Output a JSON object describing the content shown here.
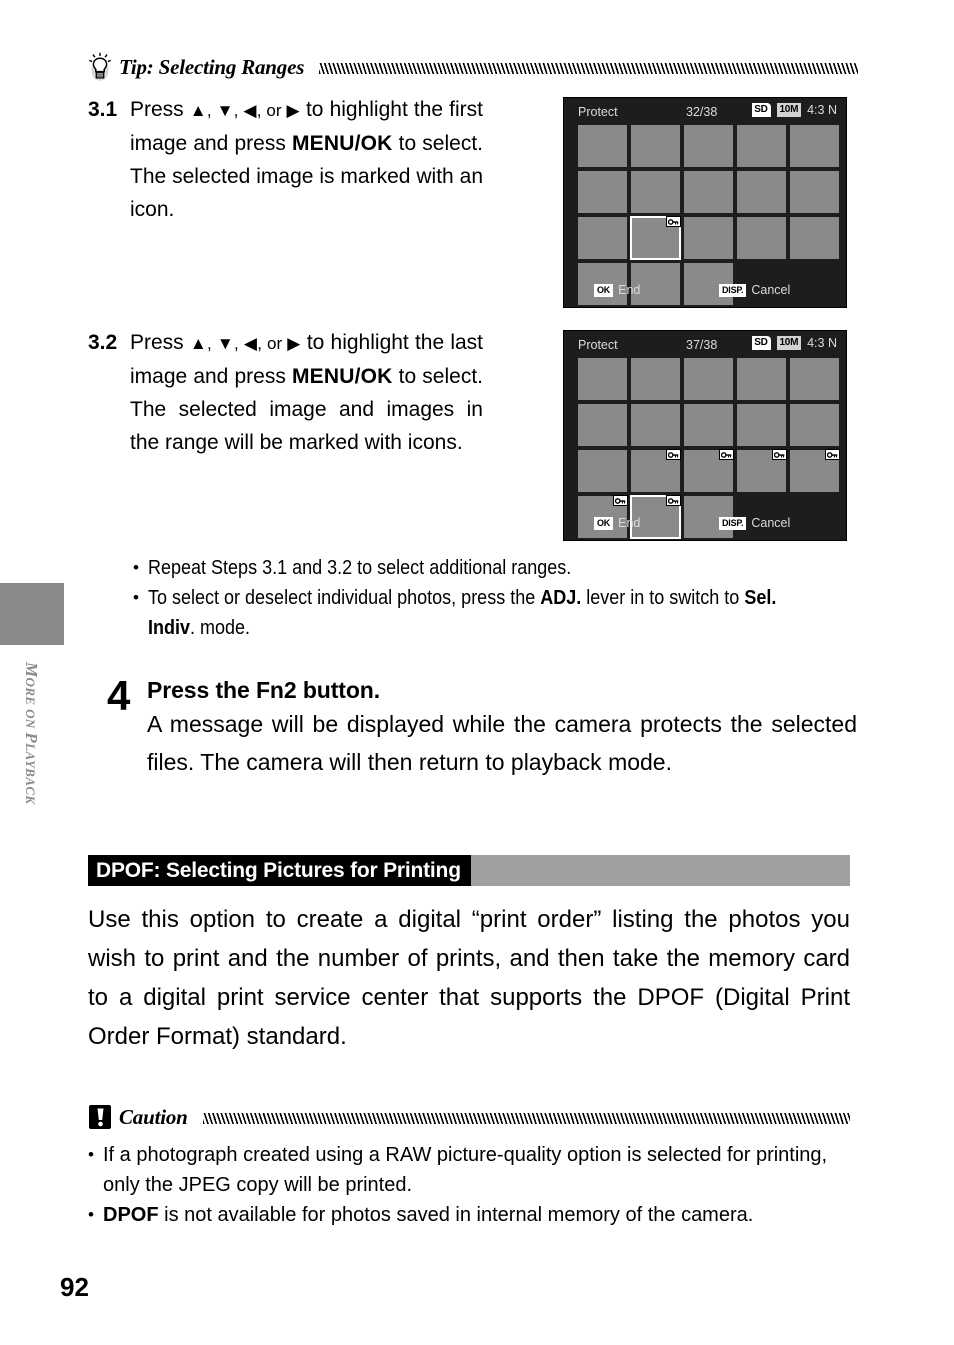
{
  "sidebar": {
    "tab_label_parts": {
      "m": "M",
      "ore_on": "ORE ON ",
      "p": "P",
      "layback": "LAYBACK"
    },
    "tab_label": "MORE ON PLAYBACK"
  },
  "page_number": "92",
  "tip": {
    "icon": "lightbulb-icon",
    "title": "Tip: Selecting Ranges",
    "steps": [
      {
        "number": "3.1",
        "text_parts": {
          "a": "Press ",
          "arrows": "▲, ▼, ◀, or ▶",
          "b": " to highlight the first image and press ",
          "bold": "MENU/OK",
          "c": " to select. The selected image is marked with an icon."
        }
      },
      {
        "number": "3.2",
        "text_parts": {
          "a": "Press ",
          "arrows": "▲, ▼, ◀, or ▶",
          "b": " to highlight the last image and press ",
          "bold": "MENU/OK",
          "c": " to select. The selected image and images in the range will be marked with icons."
        }
      }
    ]
  },
  "lcd_screens": [
    {
      "title": "Protect",
      "count": "32/38",
      "badge_sd": "SD",
      "badge_size": "10M",
      "badge_ratio": "4:3 N",
      "footer_ok_key": "OK",
      "footer_ok_label": "End",
      "footer_disp_key": "DISP.",
      "footer_disp_label": "Cancel",
      "grid": {
        "columns": 5,
        "rows": 4,
        "cells": [
          {
            "present": true,
            "lock": false,
            "selected": false
          },
          {
            "present": true,
            "lock": false,
            "selected": false
          },
          {
            "present": true,
            "lock": false,
            "selected": false
          },
          {
            "present": true,
            "lock": false,
            "selected": false
          },
          {
            "present": true,
            "lock": false,
            "selected": false
          },
          {
            "present": true,
            "lock": false,
            "selected": false
          },
          {
            "present": true,
            "lock": false,
            "selected": false
          },
          {
            "present": true,
            "lock": false,
            "selected": false
          },
          {
            "present": true,
            "lock": false,
            "selected": false
          },
          {
            "present": true,
            "lock": false,
            "selected": false
          },
          {
            "present": true,
            "lock": false,
            "selected": false
          },
          {
            "present": true,
            "lock": true,
            "selected": true
          },
          {
            "present": true,
            "lock": false,
            "selected": false
          },
          {
            "present": true,
            "lock": false,
            "selected": false
          },
          {
            "present": true,
            "lock": false,
            "selected": false
          },
          {
            "present": true,
            "lock": false,
            "selected": false
          },
          {
            "present": true,
            "lock": false,
            "selected": false
          },
          {
            "present": true,
            "lock": false,
            "selected": false
          },
          {
            "present": false,
            "lock": false,
            "selected": false
          },
          {
            "present": false,
            "lock": false,
            "selected": false
          }
        ]
      }
    },
    {
      "title": "Protect",
      "count": "37/38",
      "badge_sd": "SD",
      "badge_size": "10M",
      "badge_ratio": "4:3 N",
      "footer_ok_key": "OK",
      "footer_ok_label": "End",
      "footer_disp_key": "DISP.",
      "footer_disp_label": "Cancel",
      "grid": {
        "columns": 5,
        "rows": 4,
        "cells": [
          {
            "present": true,
            "lock": false,
            "selected": false
          },
          {
            "present": true,
            "lock": false,
            "selected": false
          },
          {
            "present": true,
            "lock": false,
            "selected": false
          },
          {
            "present": true,
            "lock": false,
            "selected": false
          },
          {
            "present": true,
            "lock": false,
            "selected": false
          },
          {
            "present": true,
            "lock": false,
            "selected": false
          },
          {
            "present": true,
            "lock": false,
            "selected": false
          },
          {
            "present": true,
            "lock": false,
            "selected": false
          },
          {
            "present": true,
            "lock": false,
            "selected": false
          },
          {
            "present": true,
            "lock": false,
            "selected": false
          },
          {
            "present": true,
            "lock": false,
            "selected": false
          },
          {
            "present": true,
            "lock": true,
            "selected": false
          },
          {
            "present": true,
            "lock": true,
            "selected": false
          },
          {
            "present": true,
            "lock": true,
            "selected": false
          },
          {
            "present": true,
            "lock": true,
            "selected": false
          },
          {
            "present": true,
            "lock": true,
            "selected": false
          },
          {
            "present": true,
            "lock": true,
            "selected": true
          },
          {
            "present": true,
            "lock": false,
            "selected": false
          },
          {
            "present": false,
            "lock": false,
            "selected": false
          },
          {
            "present": false,
            "lock": false,
            "selected": false
          }
        ]
      }
    }
  ],
  "range_notes": [
    {
      "parts": [
        {
          "text": "Repeat Steps 3.1 and 3.2 to select additional ranges.",
          "bold": false
        }
      ]
    },
    {
      "parts": [
        {
          "text": "To select or deselect individual photos, press the ",
          "bold": false
        },
        {
          "text": "ADJ.",
          "bold": true
        },
        {
          "text": " lever in to switch to ",
          "bold": false
        },
        {
          "text": "Sel. Indiv",
          "bold": true
        },
        {
          "text": ". mode.",
          "bold": false
        }
      ]
    }
  ],
  "step4": {
    "number": "4",
    "title": "Press the Fn2 button.",
    "text": "A message will be displayed while the camera protects the selected files. The camera will then return to playback mode."
  },
  "dpof_section": {
    "heading": "DPOF: Selecting Pictures for Printing",
    "body": "Use this option to create a digital “print order” listing the photos you wish to print and the number of prints, and then take the memory card to a digital print service center that supports the DPOF (Digital Print Order Format) standard."
  },
  "caution": {
    "icon": "caution-exclamation-icon",
    "title": "Caution",
    "notes": [
      {
        "parts": [
          {
            "text": "If a photograph created using a RAW picture-quality option is selected for printing, only the JPEG copy will be printed.",
            "bold": false
          }
        ]
      },
      {
        "parts": [
          {
            "text": "DPOF",
            "bold": true
          },
          {
            "text": " is not available for photos saved in internal memory of the camera.",
            "bold": false
          }
        ]
      }
    ]
  },
  "colors": {
    "tab_gray": "#8a8a8a",
    "bar_gray": "#a0a0a0",
    "lcd_background": "#1d1d1d",
    "thumbnail_gray": "#8a8a8a"
  }
}
